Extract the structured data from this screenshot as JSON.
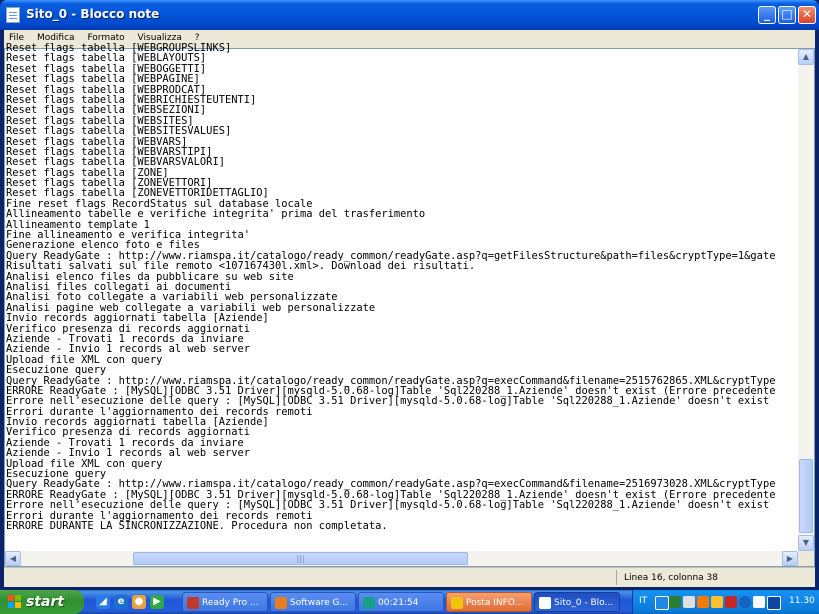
{
  "window": {
    "title": "Sito_0 - Blocco note",
    "buttons": {
      "minimize": "_",
      "maximize": "□",
      "close": "✕"
    }
  },
  "menu": [
    "File",
    "Modifica",
    "Formato",
    "Visualizza",
    "?"
  ],
  "editor": {
    "lines": [
      "Reset flags tabella [WEBGROUPSLINKS]",
      "Reset flags tabella [WEBLAYOUTS]",
      "Reset flags tabella [WEBOGGETTI]",
      "Reset flags tabella [WEBPAGINE]",
      "Reset flags tabella [WEBPRODCAT]",
      "Reset flags tabella [WEBRICHIESTEUTENTI]",
      "Reset flags tabella [WEBSEZIONI]",
      "Reset flags tabella [WEBSITES]",
      "Reset flags tabella [WEBSITESVALUES]",
      "Reset flags tabella [WEBVARS]",
      "Reset flags tabella [WEBVARSTIPI]",
      "Reset flags tabella [WEBVARSVALORI]",
      "Reset flags tabella [ZONE]",
      "Reset flags tabella [ZONEVETTORI]",
      "Reset flags tabella [ZONEVETTORIDETTAGLIO]",
      "Fine reset flags RecordStatus sul database locale",
      "Allineamento tabelle e verifiche integrita' prima del trasferimento",
      "Allineamento template 1",
      "Fine allineamento e verifica integrita'",
      "Generazione elenco foto e files",
      "Query ReadyGate : http://www.riamspa.it/catalogo/ready_common/readyGate.asp?q=getFilesStructure&path=files&cryptType=1&gate",
      "Risultati salvati sul file remoto <107167430l.xml>. Download dei risultati.",
      "Analisi elenco files da pubblicare su web site",
      "Analisi files collegati ai documenti",
      "Analisi foto collegate a variabili web personalizzate",
      "Analisi pagine web collegate a variabili web personalizzate",
      "Invio records aggiornati tabella [Aziende]",
      "Verifico presenza di records aggiornati",
      "Aziende - Trovati 1 records da inviare",
      "Aziende - Invio 1 records al web server",
      "Upload file XML con query",
      "Esecuzione query",
      "Query ReadyGate : http://www.riamspa.it/catalogo/ready_common/readyGate.asp?q=execCommand&filename=2515762865.XML&cryptType",
      "ERRORE ReadyGate : [MySQL][ODBC 3.51 Driver][mysqld-5.0.68-log]Table 'Sql220288_1.Aziende' doesn't exist (Errore precedente",
      "Errore nell'esecuzione delle query : [MySQL][ODBC 3.51 Driver][mysqld-5.0.68-log]Table 'Sql220288_1.Aziende' doesn't exist",
      "Errori durante l'aggiornamento dei records remoti",
      "Invio records aggiornati tabella [Aziende]",
      "Verifico presenza di records aggiornati",
      "Aziende - Trovati 1 records da inviare",
      "Aziende - Invio 1 records al web server",
      "Upload file XML con query",
      "Esecuzione query",
      "Query ReadyGate : http://www.riamspa.it/catalogo/ready_common/readyGate.asp?q=execCommand&filename=2516973028.XML&cryptType",
      "ERRORE ReadyGate : [MySQL][ODBC 3.51 Driver][mysqld-5.0.68-log]Table 'Sql220288_1.Aziende' doesn't exist (Errore precedente",
      "Errore nell'esecuzione delle query : [MySQL][ODBC 3.51 Driver][mysqld-5.0.68-log]Table 'Sql220288_1.Aziende' doesn't exist",
      "Errori durante l'aggiornamento dei records remoti",
      "ERRORE DURANTE LA SINCRONIZZAZIONE. Procedura non completata."
    ]
  },
  "scrollbars": {
    "up": "▲",
    "down": "▼",
    "left": "◀",
    "right": "▶",
    "grip": "|||"
  },
  "status": {
    "position": "Linea 16, colonna 38"
  },
  "taskbar": {
    "start_label": "start",
    "tasks": [
      {
        "label": "Ready Pro ...",
        "icon_color": "#c0392b"
      },
      {
        "label": "Software G...",
        "icon_color": "#e67e22"
      },
      {
        "label": "00:21:54",
        "icon_color": "#16a085"
      },
      {
        "label": "Posta INFO...",
        "icon_color": "#f1c40f"
      },
      {
        "label": "Sito_0 - Blo...",
        "icon_color": "#ffffff"
      }
    ],
    "tray": {
      "lang": "IT",
      "clock": "11.30"
    }
  }
}
